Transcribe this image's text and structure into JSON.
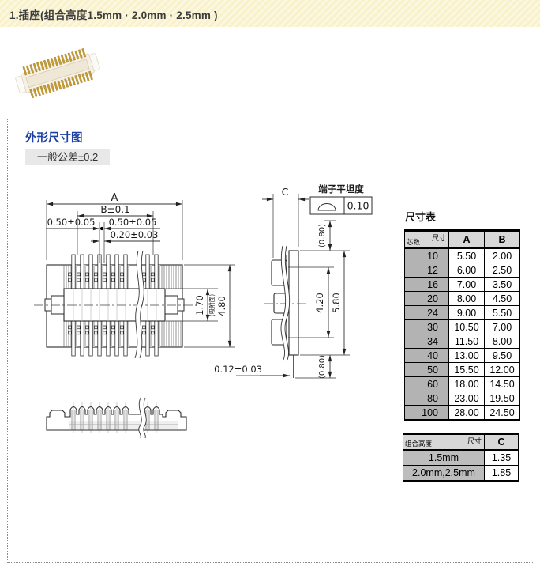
{
  "header": {
    "title": "1.插座(组合高度1.5mm · 2.0mm · 2.5mm )"
  },
  "colors": {
    "accent_blue": "#1d3fa6",
    "header_stripe_a": "#f8f1c9",
    "header_stripe_b": "#fcf7e0",
    "chip_bg": "#e8e8e8",
    "table_header_bg": "#d8d8d8",
    "table_label_bg": "#b3b3b3",
    "pin_gold": "#c79b32"
  },
  "panel": {
    "section_title": "外形尺寸图",
    "tolerance_label": "一般公差±0.2",
    "drawing": {
      "dim_A": "A",
      "dim_B": "B±0.1",
      "dim_050_left": "0.50±0.05",
      "dim_050_right": "0.50±0.05",
      "dim_020": "0.20±0.03",
      "dim_170": "1.70",
      "suction_note": "(吸附面)",
      "dim_480": "4.80",
      "dim_C": "C",
      "flatness_title": "端子平坦度",
      "flatness_value": "0.10",
      "dim_080_top": "(0.80)",
      "dim_080_bottom": "(0.80)",
      "dim_420": "4.20",
      "dim_580": "5.80",
      "dim_012": "0.12±0.03"
    },
    "size_table": {
      "title": "尺寸表",
      "corner_top": "尺寸",
      "corner_bottom": "芯数",
      "columns": [
        "A",
        "B"
      ],
      "rows": [
        {
          "pins": "10",
          "a": "5.50",
          "b": "2.00"
        },
        {
          "pins": "12",
          "a": "6.00",
          "b": "2.50"
        },
        {
          "pins": "16",
          "a": "7.00",
          "b": "3.50"
        },
        {
          "pins": "20",
          "a": "8.00",
          "b": "4.50"
        },
        {
          "pins": "24",
          "a": "9.00",
          "b": "5.50"
        },
        {
          "pins": "30",
          "a": "10.50",
          "b": "7.00"
        },
        {
          "pins": "34",
          "a": "11.50",
          "b": "8.00"
        },
        {
          "pins": "40",
          "a": "13.00",
          "b": "9.50"
        },
        {
          "pins": "50",
          "a": "15.50",
          "b": "12.00"
        },
        {
          "pins": "60",
          "a": "18.00",
          "b": "14.50"
        },
        {
          "pins": "80",
          "a": "23.00",
          "b": "19.50"
        },
        {
          "pins": "100",
          "a": "28.00",
          "b": "24.50"
        }
      ]
    },
    "height_table": {
      "corner_top": "尺寸",
      "corner_bottom": "组合高度",
      "column": "C",
      "rows": [
        {
          "label": "1.5mm",
          "c": "1.35"
        },
        {
          "label": "2.0mm,2.5mm",
          "c": "1.85"
        }
      ]
    }
  }
}
